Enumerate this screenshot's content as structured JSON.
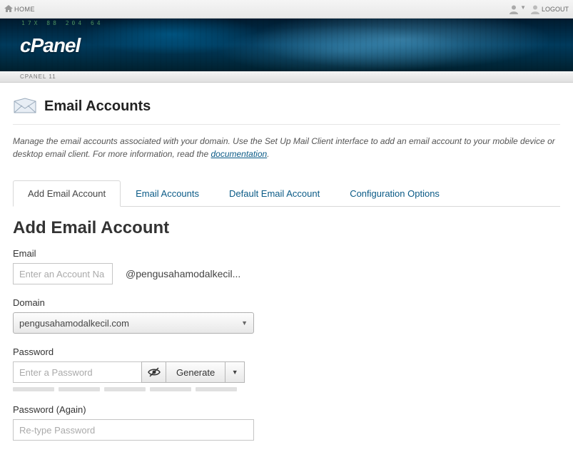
{
  "topbar": {
    "home_label": "HOME",
    "logout_label": "LOGOUT"
  },
  "banner": {
    "brand": "cPanel",
    "ticker": "17X  88  204  64"
  },
  "subbar": {
    "text": "CPANEL 11"
  },
  "page": {
    "title": "Email Accounts",
    "intro_part1": "Manage the email accounts associated with your domain. Use the Set Up Mail Client interface to add an email account to your mobile device or desktop email client. For more information, read the ",
    "intro_link": "documentation",
    "intro_part2": "."
  },
  "tabs": [
    {
      "label": "Add Email Account",
      "active": true
    },
    {
      "label": "Email Accounts",
      "active": false
    },
    {
      "label": "Default Email Account",
      "active": false
    },
    {
      "label": "Configuration Options",
      "active": false
    }
  ],
  "form": {
    "section_title": "Add Email Account",
    "email_label": "Email",
    "email_placeholder": "Enter an Account Na",
    "email_domain_text": "@pengusahamodalkecil...",
    "domain_label": "Domain",
    "domain_selected": "pengusahamodalkecil.com",
    "password_label": "Password",
    "password_placeholder": "Enter a Password",
    "generate_label": "Generate",
    "password2_label": "Password (Again)",
    "password2_placeholder": "Re-type Password"
  }
}
